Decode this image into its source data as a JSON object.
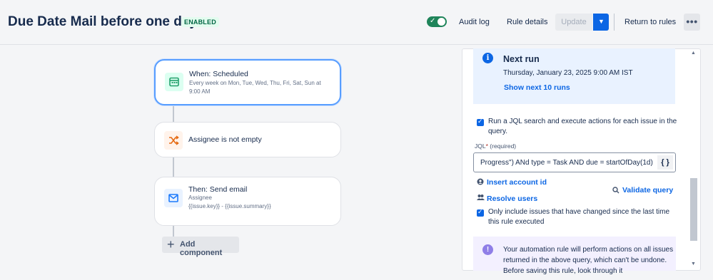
{
  "header": {
    "title": "Due Date Mail before one day",
    "status_badge": "ENABLED",
    "toggle_on": true,
    "audit_log": "Audit log",
    "rule_details": "Rule details",
    "update": "Update",
    "return_to_rules": "Return to rules",
    "more": "•••"
  },
  "canvas": {
    "trigger": {
      "title": "When: Scheduled",
      "subtitle": "Every week on Mon, Tue, Wed, Thu, Fri, Sat, Sun at 9:00 AM",
      "icon": "calendar-icon",
      "color": "#22a06b"
    },
    "condition": {
      "title": "Assignee is not empty",
      "icon": "shuffle-icon",
      "color": "#e56910"
    },
    "action": {
      "title": "Then: Send email",
      "line1": "Assignee",
      "line2": "{{issue.key}} - {{issue.summary}}",
      "icon": "mail-icon",
      "color": "#1d7afc"
    },
    "add_component": "Add component"
  },
  "panel": {
    "next_run": {
      "title": "Next run",
      "date": "Thursday, January 23, 2025 9:00 AM IST",
      "link": "Show next 10 runs"
    },
    "jql_search": {
      "checked": true,
      "label": "Run a JQL search and execute actions for each issue in the query."
    },
    "jql": {
      "label": "JQL",
      "required_marker": "*",
      "required_text": "(required)",
      "value": "Progress\") ANd type = Task AND due = startOfDay(1d)",
      "brace_button": "{ }"
    },
    "insert_account_id": "Insert account id",
    "resolve_users": "Resolve users",
    "validate_query": "Validate query",
    "only_changed": {
      "checked": true,
      "label": "Only include issues that have changed since the last time this rule executed"
    },
    "notice": "Your automation rule will perform actions on all issues returned in the above query, which can't be undone. Before saving this rule, look through it"
  }
}
